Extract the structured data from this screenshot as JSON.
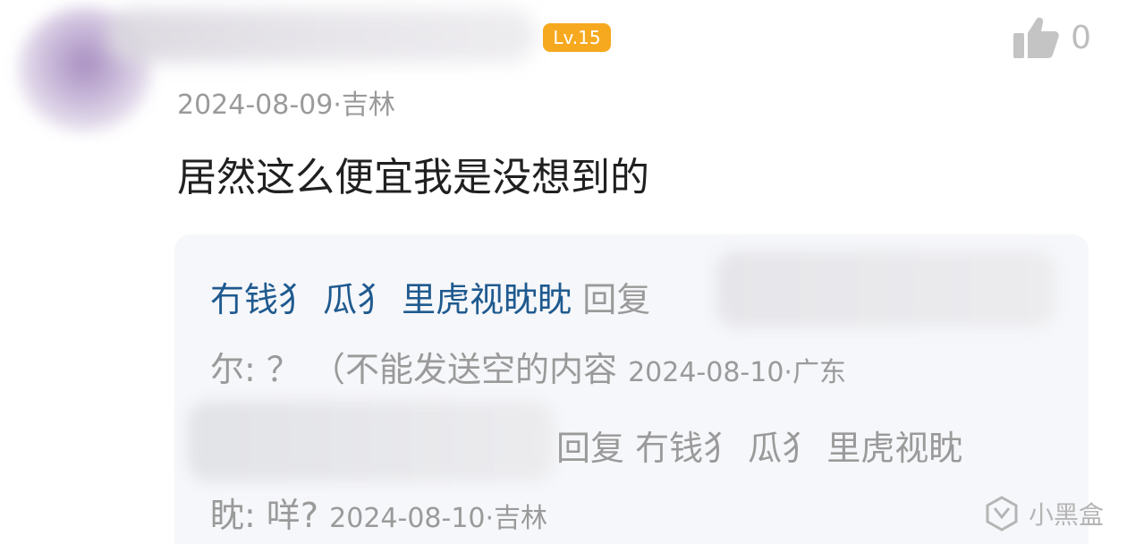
{
  "comment": {
    "level": "Lv.15",
    "like_count": "0",
    "date": "2024-08-09",
    "location": "吉林",
    "text": "居然这么便宜我是没想到的"
  },
  "replies": [
    {
      "author": "冇钱犭 瓜犭 里虎视眈眈",
      "reply_word": "回复",
      "continuation": "尔: ？ （不能发送空的内容",
      "date": "2024-08-10",
      "location": "广东"
    },
    {
      "reply_prefix": "回复 冇钱犭 瓜犭 里虎视眈",
      "continuation": "眈: 咩?",
      "date": "2024-08-10",
      "location": "吉林"
    }
  ],
  "watermark": {
    "text": "小黑盒"
  },
  "icons": {
    "like": "thumbs-up-icon",
    "watermark": "xiaoheihe-logo-icon"
  },
  "colors": {
    "badge": "#f6a91f",
    "author": "#1f5a8f",
    "meta": "#9a9a9a",
    "reply_bg": "#f6f7fa"
  }
}
